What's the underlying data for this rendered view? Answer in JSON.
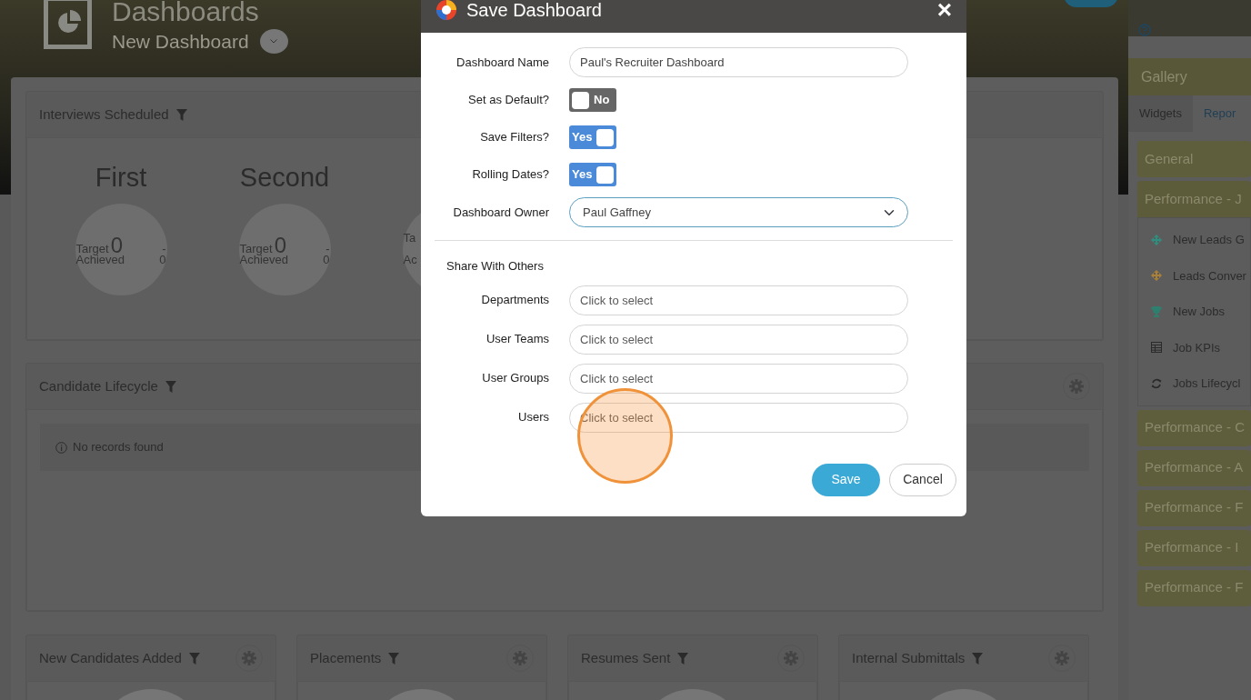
{
  "header": {
    "title": "Dashboards",
    "subtitle": "New Dashboard"
  },
  "interviews": {
    "title": "Interviews Scheduled",
    "gauges": [
      {
        "title": "First",
        "target_label": "Target",
        "target_value": "0",
        "target_dash": "-",
        "achieved_label": "Achieved",
        "achieved_value": "0"
      },
      {
        "title": "Second",
        "target_label": "Target",
        "target_value": "0",
        "target_dash": "-",
        "achieved_label": "Achieved",
        "achieved_value": "0"
      },
      {
        "target_label": "Ta",
        "achieved_label": "Ac"
      }
    ]
  },
  "lifecycle": {
    "title": "Candidate Lifecycle",
    "message": "No records found"
  },
  "bottom_cards": [
    {
      "title": "New Candidates Added"
    },
    {
      "title": "Placements"
    },
    {
      "title": "Resumes Sent"
    },
    {
      "title": "Internal Submittals"
    }
  ],
  "sidebar": {
    "title": "Gallery",
    "tabs": [
      {
        "label": "Widgets",
        "selected": true
      },
      {
        "label": "Repor",
        "selected": false
      }
    ],
    "groups": [
      {
        "title": "General",
        "expanded": false
      },
      {
        "title": "Performance - J",
        "expanded": true,
        "items": [
          {
            "label": "New Leads G",
            "kind": "arrows",
            "color": "#2f8f7f"
          },
          {
            "label": "Leads Conver",
            "kind": "arrows",
            "color": "#a8803a"
          },
          {
            "label": "New Jobs",
            "kind": "trophy",
            "color": "#2f7f6f"
          },
          {
            "label": "Job KPIs",
            "kind": "table",
            "color": "#2a2a2a"
          },
          {
            "label": "Jobs Lifecycl",
            "kind": "cycle",
            "color": "#2a2a2a"
          }
        ]
      },
      {
        "title": "Performance - C",
        "expanded": false
      },
      {
        "title": "Performance - A",
        "expanded": false
      },
      {
        "title": "Performance - F",
        "expanded": false
      },
      {
        "title": "Performance - I",
        "expanded": false
      },
      {
        "title": "Performance - F",
        "expanded": false
      }
    ]
  },
  "dialog": {
    "title": "Save Dashboard",
    "close": "×",
    "fields": [
      {
        "kind": "text",
        "label": "Dashboard Name",
        "value": "Paul's Recruiter Dashboard"
      },
      {
        "kind": "toggle",
        "label": "Set as Default?",
        "on": false,
        "text": "No"
      },
      {
        "kind": "toggle",
        "label": "Save Filters?",
        "on": true,
        "text": "Yes"
      },
      {
        "kind": "toggle",
        "label": "Rolling Dates?",
        "on": true,
        "text": "Yes"
      },
      {
        "kind": "select",
        "label": "Dashboard Owner",
        "value": "Paul Gaffney"
      }
    ],
    "share_heading": "Share With Others",
    "share_fields": [
      {
        "label": "Departments",
        "placeholder": "Click to select"
      },
      {
        "label": "User Teams",
        "placeholder": "Click to select"
      },
      {
        "label": "User Groups",
        "placeholder": "Click to select"
      },
      {
        "label": "Users",
        "placeholder": "Click to select"
      }
    ],
    "buttons": [
      {
        "label": "Save",
        "kind": "primary"
      },
      {
        "label": "Cancel",
        "kind": "secondary"
      }
    ]
  }
}
